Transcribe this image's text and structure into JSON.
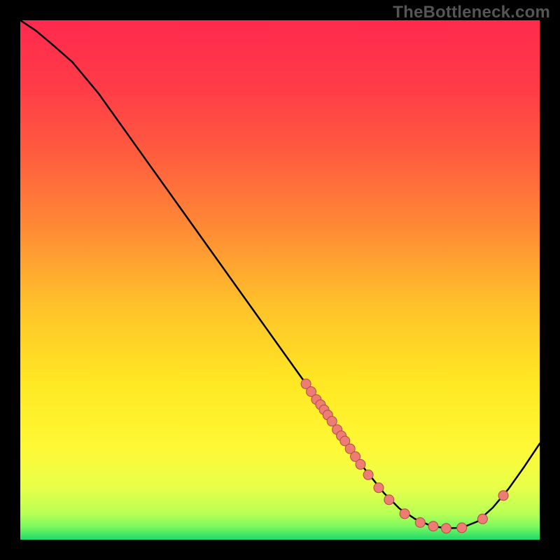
{
  "watermark": "TheBottleneck.com",
  "colors": {
    "dot_fill": "#ed7d74",
    "dot_stroke": "#b04c44",
    "curve": "#000000"
  },
  "gradient_stops": [
    {
      "offset": 0.0,
      "color": "#ff2a4d"
    },
    {
      "offset": 0.12,
      "color": "#ff3a48"
    },
    {
      "offset": 0.25,
      "color": "#ff5a3f"
    },
    {
      "offset": 0.4,
      "color": "#ff8a35"
    },
    {
      "offset": 0.55,
      "color": "#ffc22a"
    },
    {
      "offset": 0.7,
      "color": "#ffe823"
    },
    {
      "offset": 0.82,
      "color": "#fff835"
    },
    {
      "offset": 0.9,
      "color": "#e8ff4a"
    },
    {
      "offset": 0.95,
      "color": "#b8ff55"
    },
    {
      "offset": 0.975,
      "color": "#7bf85e"
    },
    {
      "offset": 1.0,
      "color": "#1fd96c"
    }
  ],
  "chart_data": {
    "type": "line",
    "title": "",
    "xlabel": "",
    "ylabel": "",
    "xlim": [
      0,
      100
    ],
    "ylim": [
      0,
      100
    ],
    "series": [
      {
        "name": "bottleneck-curve",
        "x": [
          0,
          3,
          6,
          10,
          15,
          20,
          25,
          30,
          35,
          40,
          45,
          50,
          55,
          58,
          60,
          63,
          66,
          70,
          73,
          76,
          79,
          82,
          85,
          88,
          91,
          94,
          97,
          100
        ],
        "y": [
          100,
          98,
          95.5,
          92,
          86,
          79,
          72,
          65,
          58,
          51,
          44,
          37,
          30,
          25.5,
          22.5,
          18,
          14,
          9,
          6,
          4,
          2.7,
          2.2,
          2.3,
          3.5,
          6.2,
          9.8,
          14,
          18.5
        ]
      }
    ],
    "dots": [
      {
        "x": 55,
        "y": 30
      },
      {
        "x": 56,
        "y": 28.5
      },
      {
        "x": 57,
        "y": 27
      },
      {
        "x": 57.8,
        "y": 26
      },
      {
        "x": 58.5,
        "y": 25
      },
      {
        "x": 59.2,
        "y": 24
      },
      {
        "x": 60,
        "y": 22.8
      },
      {
        "x": 61,
        "y": 21.2
      },
      {
        "x": 61.8,
        "y": 20
      },
      {
        "x": 62.5,
        "y": 19
      },
      {
        "x": 63.5,
        "y": 17.5
      },
      {
        "x": 64.5,
        "y": 16
      },
      {
        "x": 65.5,
        "y": 14.5
      },
      {
        "x": 67,
        "y": 12.5
      },
      {
        "x": 69,
        "y": 10
      },
      {
        "x": 71,
        "y": 7.7
      },
      {
        "x": 74,
        "y": 5
      },
      {
        "x": 77,
        "y": 3.3
      },
      {
        "x": 79.5,
        "y": 2.6
      },
      {
        "x": 82,
        "y": 2.2
      },
      {
        "x": 85,
        "y": 2.3
      },
      {
        "x": 89,
        "y": 4
      },
      {
        "x": 93,
        "y": 8.5
      }
    ],
    "dot_radius_px": 7
  }
}
